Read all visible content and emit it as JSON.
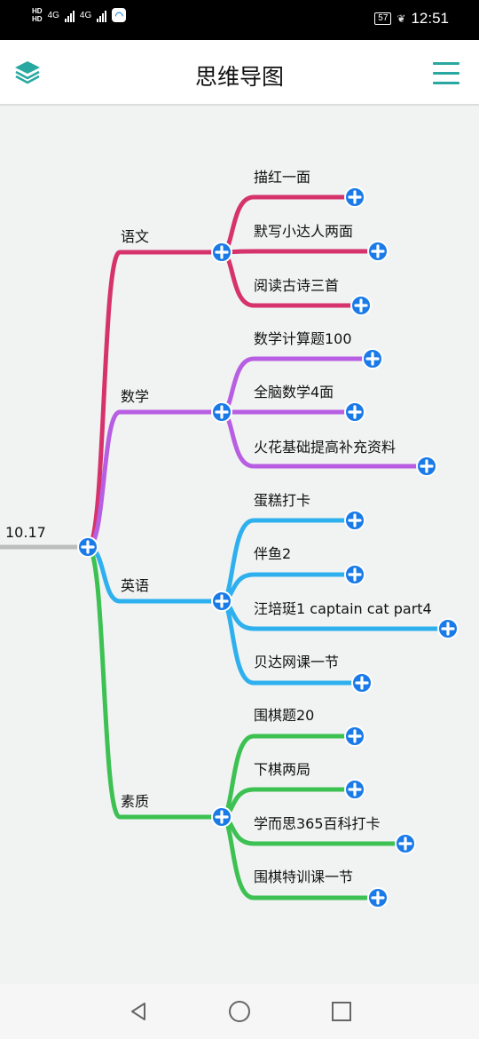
{
  "status_bar": {
    "hd1": "HD",
    "hd2": "HD",
    "net1": "4G",
    "net2": "4G",
    "battery": "57",
    "time": "12:51"
  },
  "app_bar": {
    "title": "思维导图",
    "left_icon": "layers-icon",
    "right_icon": "menu-icon"
  },
  "mindmap": {
    "root": "10.17",
    "colors": {
      "root_line": "#bdbdbd",
      "node_button": "#1a7be8",
      "chinese": "#d6336c",
      "math": "#b85ee3",
      "english": "#2fb0ee",
      "quality": "#3cc152"
    },
    "branches": [
      {
        "label": "语文",
        "children": [
          "描红一面",
          "默写小达人两面",
          "阅读古诗三首"
        ]
      },
      {
        "label": "数学",
        "children": [
          "数学计算题100",
          "全脑数学4面",
          "火花基础提高补充资料"
        ]
      },
      {
        "label": "英语",
        "children": [
          "蛋糕打卡",
          "伴鱼2",
          "汪培珽1 captain cat part4",
          "贝达网课一节"
        ]
      },
      {
        "label": "素质",
        "children": [
          "围棋题20",
          "下棋两局",
          "学而思365百科打卡",
          "围棋特训课一节"
        ]
      }
    ]
  },
  "nav_bar": {
    "back_icon": "back-triangle-icon",
    "home_icon": "home-circle-icon",
    "recent_icon": "recent-square-icon"
  }
}
